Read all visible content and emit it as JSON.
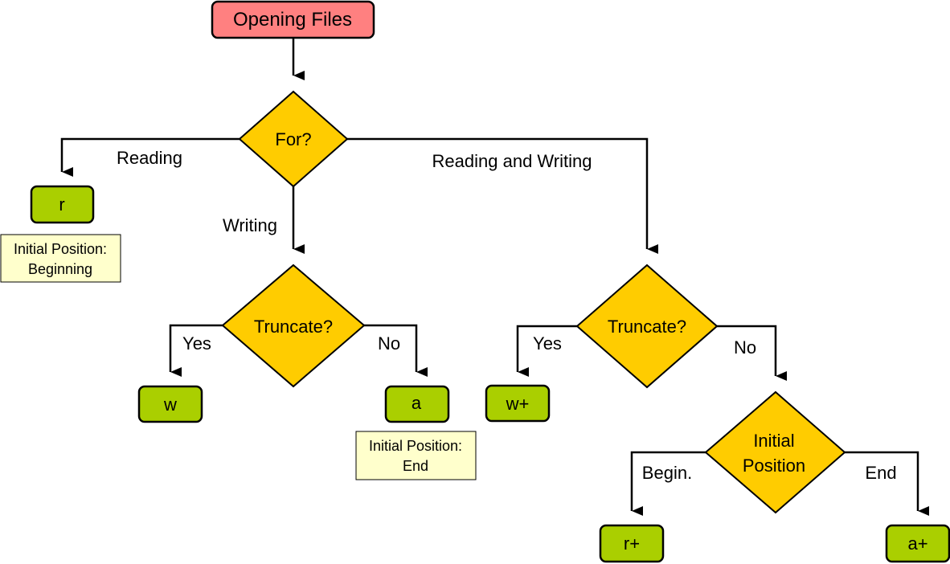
{
  "title": "Opening Files",
  "colors": {
    "start": "#ff8080",
    "decision": "#ffcc00",
    "mode": "#aacf00",
    "note": "#ffffcc",
    "stroke": "#000000"
  },
  "decisions": {
    "for": "For?",
    "truncate_write": "Truncate?",
    "truncate_rw": "Truncate?",
    "initial_position": [
      "Initial",
      "Position"
    ]
  },
  "edge_labels": {
    "reading": "Reading",
    "writing": "Writing",
    "reading_and_writing": "Reading and Writing",
    "write_yes": "Yes",
    "write_no": "No",
    "rw_yes": "Yes",
    "rw_no": "No",
    "begin": "Begin.",
    "end": "End"
  },
  "modes": {
    "r": "r",
    "w": "w",
    "a": "a",
    "w_plus": "w+",
    "r_plus": "r+",
    "a_plus": "a+"
  },
  "notes": {
    "r": [
      "Initial Position:",
      "Beginning"
    ],
    "a": [
      "Initial Position:",
      "End"
    ]
  }
}
